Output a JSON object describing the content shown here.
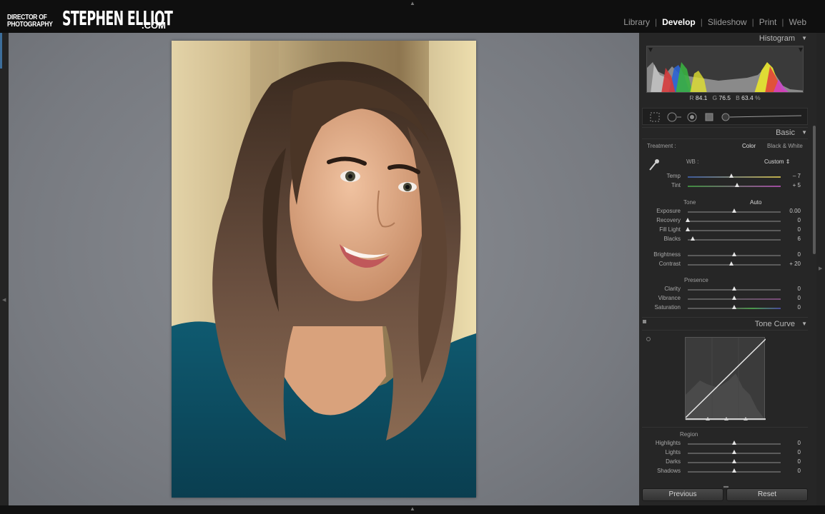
{
  "brand": {
    "line1": "DIRECTOR OF",
    "line2": "PHOTOGRAPHY",
    "name": "STEPHEN ELLIOT",
    "suffix": ".COM"
  },
  "modules": [
    {
      "label": "Library",
      "active": false
    },
    {
      "label": "Develop",
      "active": true
    },
    {
      "label": "Slideshow",
      "active": false
    },
    {
      "label": "Print",
      "active": false
    },
    {
      "label": "Web",
      "active": false
    }
  ],
  "histogram": {
    "title": "Histogram",
    "r_label": "R",
    "r_value": "84.1",
    "g_label": "G",
    "g_value": "76.5",
    "b_label": "B",
    "b_value": "63.4",
    "pct": "%"
  },
  "basic": {
    "title": "Basic",
    "treatment_label": "Treatment :",
    "treatment_color": "Color",
    "treatment_bw": "Black & White",
    "wb_label": "WB :",
    "wb_value": "Custom",
    "temp": {
      "label": "Temp",
      "value": "– 7",
      "pos": 0.47
    },
    "tint": {
      "label": "Tint",
      "value": "+ 5",
      "pos": 0.53
    },
    "tone_label": "Tone",
    "auto_label": "Auto",
    "exposure": {
      "label": "Exposure",
      "value": "0.00",
      "pos": 0.5
    },
    "recovery": {
      "label": "Recovery",
      "value": "0",
      "pos": 0.0
    },
    "fill_light": {
      "label": "Fill Light",
      "value": "0",
      "pos": 0.0
    },
    "blacks": {
      "label": "Blacks",
      "value": "6",
      "pos": 0.05
    },
    "brightness": {
      "label": "Brightness",
      "value": "0",
      "pos": 0.5
    },
    "contrast": {
      "label": "Contrast",
      "value": "+ 20",
      "pos": 0.47
    },
    "presence_label": "Presence",
    "clarity": {
      "label": "Clarity",
      "value": "0",
      "pos": 0.5
    },
    "vibrance": {
      "label": "Vibrance",
      "value": "0",
      "pos": 0.5
    },
    "saturation": {
      "label": "Saturation",
      "value": "0",
      "pos": 0.5
    }
  },
  "tone_curve": {
    "title": "Tone Curve",
    "region_label": "Region",
    "highlights": {
      "label": "Highlights",
      "value": "0",
      "pos": 0.5
    },
    "lights": {
      "label": "Lights",
      "value": "0",
      "pos": 0.5
    },
    "darks": {
      "label": "Darks",
      "value": "0",
      "pos": 0.5
    },
    "shadows": {
      "label": "Shadows",
      "value": "0",
      "pos": 0.5
    }
  },
  "buttons": {
    "previous": "Previous",
    "reset": "Reset"
  },
  "colors": {
    "accent": "#3c6d9a",
    "panel": "#262626",
    "topbar": "#0f0f0f"
  }
}
